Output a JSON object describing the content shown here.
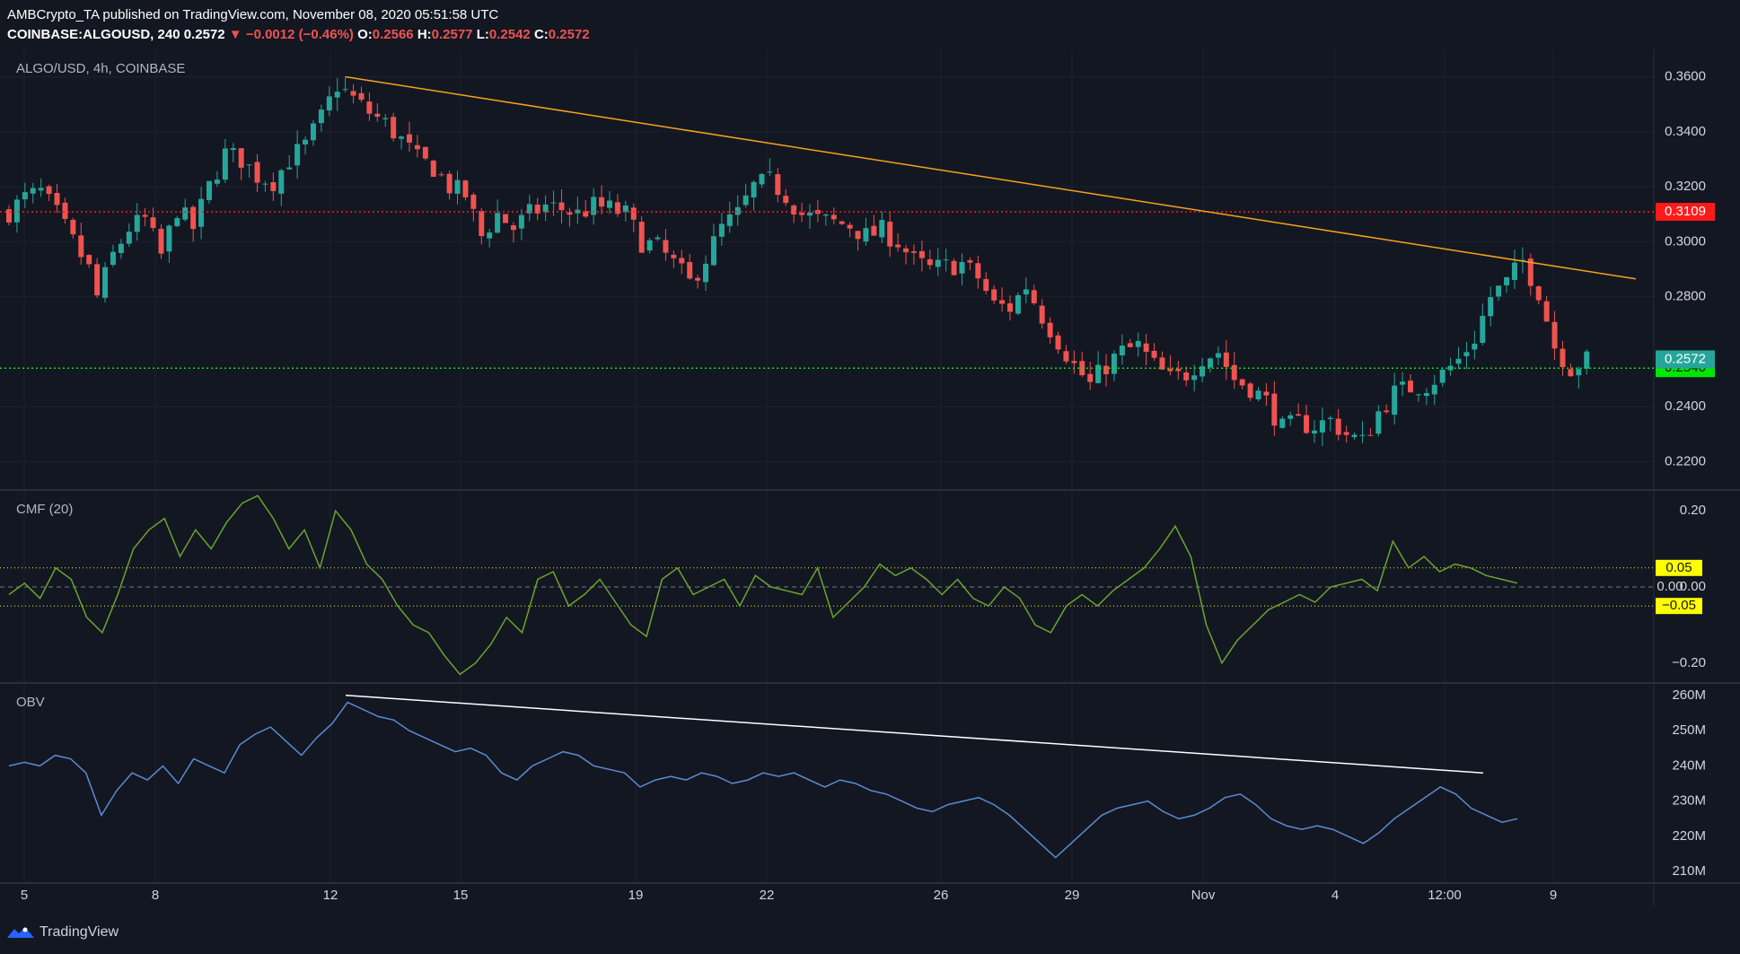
{
  "header": {
    "line1": "AMBCrypto_TA published on TradingView.com, November 08, 2020 05:51:58 UTC",
    "symbol": "COINBASE:ALGOUSD, 240",
    "last": "0.2572",
    "change_arrow": "▼",
    "change": "−0.0012 (−0.46%)",
    "o_label": "O:",
    "o": "0.2566",
    "h_label": "H:",
    "h": "0.2577",
    "l_label": "L:",
    "l": "0.2542",
    "c_label": "C:",
    "c": "0.2572"
  },
  "panes": {
    "price_title": "ALGO/USD, 4h, COINBASE",
    "cmf_title": "CMF (20)",
    "obv_title": "OBV"
  },
  "footer": {
    "brand": "TradingView"
  },
  "colors": {
    "background": "#131722",
    "up": "#26a69a",
    "down": "#ef5350",
    "resistance": "#ff1a1a",
    "support": "#00e600",
    "trendline": "#f7a21b",
    "cmf_line": "#6aa52e",
    "cmf_band": "#ffff00",
    "obv_line": "#5b8bd0",
    "obv_trend": "#ffffff"
  },
  "chart_data": [
    {
      "type": "candlestick",
      "title": "ALGO/USD, 4h, COINBASE",
      "ylim": [
        0.21,
        0.37
      ],
      "y_ticks": [
        "0.3600",
        "0.3400",
        "0.3200",
        "0.3000",
        "0.2800",
        "0.2400",
        "0.2200"
      ],
      "x_ticks": [
        "5",
        "8",
        "12",
        "15",
        "19",
        "22",
        "26",
        "29",
        "Nov",
        "4",
        "12:00",
        "9"
      ],
      "horizontal_lines": [
        {
          "value": 0.3109,
          "label": "0.3109",
          "style": "dotted"
        },
        {
          "value": 0.254,
          "label": "0.2540",
          "style": "dotted"
        }
      ],
      "last_price_label": "0.2572",
      "trendline": {
        "start": {
          "x": "Oct 12",
          "y": 0.36
        },
        "end": {
          "x": "Nov 9",
          "y": 0.287
        }
      },
      "close_path": [
        [
          0,
          0.311
        ],
        [
          2,
          0.316
        ],
        [
          4,
          0.318
        ],
        [
          6,
          0.31
        ],
        [
          8,
          0.3
        ],
        [
          10,
          0.29
        ],
        [
          11,
          0.28
        ],
        [
          13,
          0.295
        ],
        [
          15,
          0.305
        ],
        [
          17,
          0.308
        ],
        [
          19,
          0.295
        ],
        [
          21,
          0.312
        ],
        [
          23,
          0.305
        ],
        [
          25,
          0.32
        ],
        [
          27,
          0.332
        ],
        [
          29,
          0.33
        ],
        [
          31,
          0.324
        ],
        [
          33,
          0.322
        ],
        [
          35,
          0.33
        ],
        [
          37,
          0.335
        ],
        [
          39,
          0.345
        ],
        [
          41,
          0.357
        ],
        [
          43,
          0.352
        ],
        [
          45,
          0.347
        ],
        [
          47,
          0.343
        ],
        [
          49,
          0.337
        ],
        [
          51,
          0.33
        ],
        [
          53,
          0.327
        ],
        [
          55,
          0.32
        ],
        [
          57,
          0.317
        ],
        [
          59,
          0.302
        ],
        [
          61,
          0.31
        ],
        [
          63,
          0.305
        ],
        [
          65,
          0.31
        ],
        [
          67,
          0.313
        ],
        [
          69,
          0.312
        ],
        [
          71,
          0.31
        ],
        [
          73,
          0.313
        ],
        [
          75,
          0.312
        ],
        [
          77,
          0.31
        ],
        [
          79,
          0.3
        ],
        [
          81,
          0.298
        ],
        [
          83,
          0.292
        ],
        [
          85,
          0.285
        ],
        [
          87,
          0.294
        ],
        [
          89,
          0.305
        ],
        [
          91,
          0.31
        ],
        [
          93,
          0.32
        ],
        [
          95,
          0.322
        ],
        [
          97,
          0.317
        ],
        [
          99,
          0.31
        ],
        [
          101,
          0.308
        ],
        [
          103,
          0.307
        ],
        [
          105,
          0.306
        ],
        [
          107,
          0.302
        ],
        [
          109,
          0.304
        ],
        [
          111,
          0.3
        ],
        [
          113,
          0.293
        ],
        [
          115,
          0.29
        ],
        [
          117,
          0.291
        ],
        [
          119,
          0.292
        ],
        [
          121,
          0.287
        ],
        [
          123,
          0.277
        ],
        [
          125,
          0.276
        ],
        [
          127,
          0.284
        ],
        [
          129,
          0.273
        ],
        [
          131,
          0.264
        ],
        [
          133,
          0.255
        ],
        [
          135,
          0.248
        ],
        [
          137,
          0.255
        ],
        [
          139,
          0.26
        ],
        [
          141,
          0.262
        ],
        [
          143,
          0.255
        ],
        [
          145,
          0.25
        ],
        [
          147,
          0.252
        ],
        [
          149,
          0.258
        ],
        [
          151,
          0.26
        ],
        [
          153,
          0.25
        ],
        [
          155,
          0.247
        ],
        [
          157,
          0.242
        ],
        [
          159,
          0.232
        ],
        [
          161,
          0.234
        ],
        [
          163,
          0.233
        ],
        [
          165,
          0.235
        ],
        [
          167,
          0.23
        ],
        [
          169,
          0.227
        ],
        [
          171,
          0.238
        ],
        [
          173,
          0.245
        ],
        [
          175,
          0.247
        ],
        [
          177,
          0.248
        ],
        [
          179,
          0.252
        ],
        [
          181,
          0.257
        ],
        [
          183,
          0.265
        ],
        [
          185,
          0.28
        ],
        [
          187,
          0.285
        ],
        [
          189,
          0.293
        ],
        [
          191,
          0.282
        ],
        [
          193,
          0.262
        ],
        [
          195,
          0.254
        ],
        [
          197,
          0.257
        ]
      ]
    },
    {
      "type": "line",
      "title": "CMF (20)",
      "ylim": [
        -0.25,
        0.25
      ],
      "y_ticks": [
        "0.20",
        "0.00",
        "−0.20"
      ],
      "bands": [
        {
          "value": 0.05,
          "label": "0.05"
        },
        {
          "value": -0.05,
          "label": "−0.05"
        }
      ],
      "zero_label": "0.00",
      "series": [
        {
          "values": [
            -0.02,
            0.01,
            -0.03,
            0.05,
            0.02,
            -0.08,
            -0.12,
            -0.02,
            0.1,
            0.15,
            0.18,
            0.08,
            0.15,
            0.1,
            0.17,
            0.22,
            0.24,
            0.18,
            0.1,
            0.15,
            0.05,
            0.2,
            0.15,
            0.06,
            0.02,
            -0.05,
            -0.1,
            -0.12,
            -0.18,
            -0.23,
            -0.2,
            -0.15,
            -0.08,
            -0.12,
            0.02,
            0.04,
            -0.05,
            -0.02,
            0.02,
            -0.04,
            -0.1,
            -0.13,
            0.02,
            0.05,
            -0.02,
            0.0,
            0.02,
            -0.05,
            0.03,
            0.0,
            -0.01,
            -0.02,
            0.05,
            -0.08,
            -0.04,
            0.0,
            0.06,
            0.03,
            0.05,
            0.02,
            -0.02,
            0.02,
            -0.03,
            -0.05,
            0.0,
            -0.03,
            -0.1,
            -0.12,
            -0.05,
            -0.02,
            -0.05,
            -0.01,
            0.02,
            0.05,
            0.1,
            0.16,
            0.08,
            -0.1,
            -0.2,
            -0.14,
            -0.1,
            -0.06,
            -0.04,
            -0.02,
            -0.04,
            0.0,
            0.01,
            0.02,
            -0.01,
            0.12,
            0.05,
            0.08,
            0.04,
            0.06,
            0.05,
            0.03,
            0.02,
            0.01
          ]
        }
      ]
    },
    {
      "type": "line",
      "title": "OBV",
      "ylim": [
        207,
        263
      ],
      "y_ticks": [
        "260M",
        "250M",
        "240M",
        "230M",
        "220M",
        "210M"
      ],
      "trendline": {
        "start": {
          "x": "Oct 12",
          "y": 260
        },
        "end": {
          "x": "Nov 7",
          "y": 238
        }
      },
      "series": [
        {
          "values": [
            240,
            241,
            240,
            243,
            242,
            238,
            226,
            233,
            238,
            236,
            240,
            235,
            242,
            240,
            238,
            246,
            249,
            251,
            247,
            243,
            248,
            252,
            258,
            256,
            254,
            253,
            250,
            248,
            246,
            244,
            245,
            243,
            238,
            236,
            240,
            242,
            244,
            243,
            240,
            239,
            238,
            234,
            236,
            237,
            236,
            238,
            237,
            235,
            236,
            238,
            237,
            238,
            236,
            234,
            236,
            235,
            233,
            232,
            230,
            228,
            227,
            229,
            230,
            231,
            229,
            226,
            222,
            218,
            214,
            218,
            222,
            226,
            228,
            229,
            230,
            227,
            225,
            226,
            228,
            231,
            232,
            229,
            225,
            223,
            222,
            223,
            222,
            220,
            218,
            221,
            225,
            228,
            231,
            234,
            232,
            228,
            226,
            224,
            225
          ]
        }
      ]
    }
  ]
}
